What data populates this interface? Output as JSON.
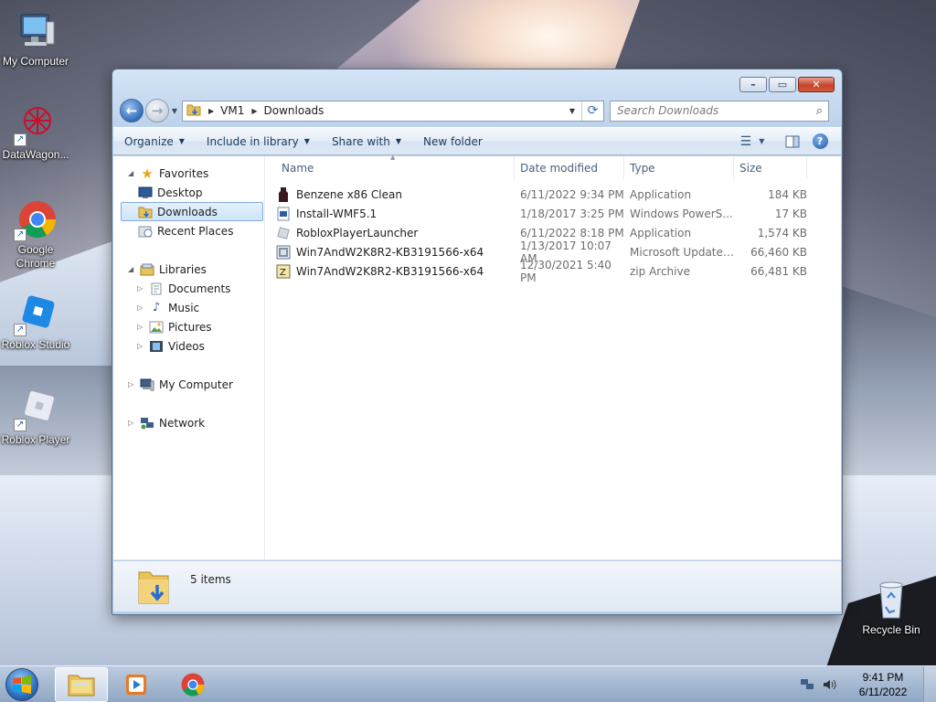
{
  "desktop": {
    "icons": [
      {
        "label": "My Computer",
        "icon": "my-computer-icon"
      },
      {
        "label": "DataWagon...",
        "icon": "datawagon-icon"
      },
      {
        "label": "Google Chrome",
        "icon": "chrome-icon"
      },
      {
        "label": "Roblox Studio",
        "icon": "roblox-studio-icon"
      },
      {
        "label": "Roblox Player",
        "icon": "roblox-player-icon"
      },
      {
        "label": "Recycle Bin",
        "icon": "recycle-bin-icon"
      }
    ]
  },
  "window": {
    "address": {
      "crumbs": [
        "VM1",
        "Downloads"
      ]
    },
    "search": {
      "placeholder": "Search Downloads"
    },
    "toolbar": {
      "organize": "Organize",
      "include_in_library": "Include in library",
      "share_with": "Share with",
      "new_folder": "New folder"
    },
    "nav_pane": {
      "favorites": {
        "label": "Favorites",
        "items": [
          "Desktop",
          "Downloads",
          "Recent Places"
        ]
      },
      "libraries": {
        "label": "Libraries",
        "items": [
          "Documents",
          "Music",
          "Pictures",
          "Videos"
        ]
      },
      "computer": "My Computer",
      "network": "Network",
      "selected": "Downloads"
    },
    "columns": {
      "name": "Name",
      "date_modified": "Date modified",
      "type": "Type",
      "size": "Size"
    },
    "files": [
      {
        "name": "Benzene x86 Clean",
        "date": "6/11/2022 9:34 PM",
        "type": "Application",
        "size": "184 KB"
      },
      {
        "name": "Install-WMF5.1",
        "date": "1/18/2017 3:25 PM",
        "type": "Windows PowerS...",
        "size": "17 KB"
      },
      {
        "name": "RobloxPlayerLauncher",
        "date": "6/11/2022 8:18 PM",
        "type": "Application",
        "size": "1,574 KB"
      },
      {
        "name": "Win7AndW2K8R2-KB3191566-x64",
        "date": "1/13/2017 10:07 AM",
        "type": "Microsoft Update ...",
        "size": "66,460 KB"
      },
      {
        "name": "Win7AndW2K8R2-KB3191566-x64",
        "date": "12/30/2021 5:40 PM",
        "type": "zip Archive",
        "size": "66,481 KB"
      }
    ],
    "status": {
      "item_count": "5 items"
    }
  },
  "taskbar": {
    "clock": {
      "time": "9:41 PM",
      "date": "6/11/2022"
    },
    "apps": [
      "file-explorer-icon",
      "media-player-icon",
      "chrome-icon"
    ]
  },
  "colors": {
    "selection": "#cde4fa",
    "toolbar_text": "#1e3a5f",
    "accent": "#2f6fbd"
  }
}
